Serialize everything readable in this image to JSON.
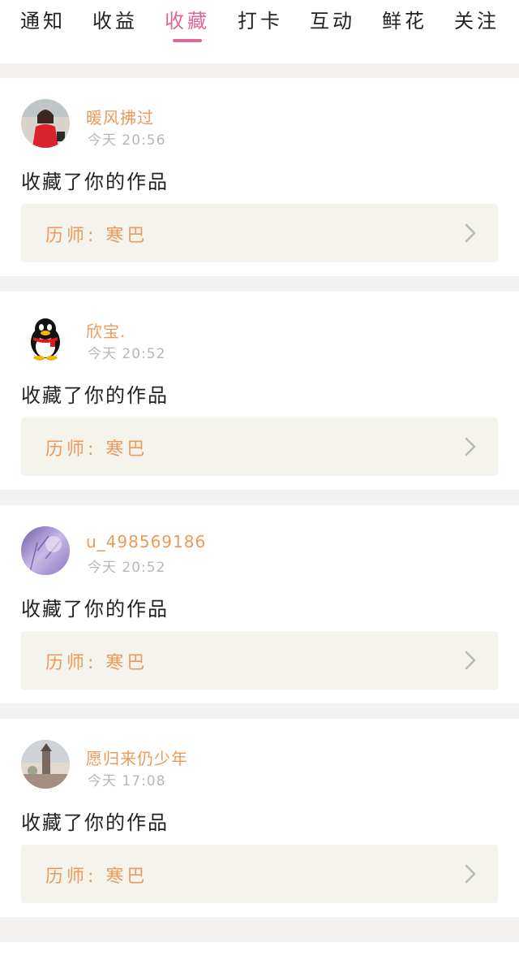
{
  "tabs": [
    {
      "label": "通知"
    },
    {
      "label": "收益"
    },
    {
      "label": "收藏"
    },
    {
      "label": "打卡"
    },
    {
      "label": "互动"
    },
    {
      "label": "鲜花"
    },
    {
      "label": "关注"
    }
  ],
  "active_tab": "收藏",
  "accent_color": "#e0669a",
  "name_color": "#ec9a5c",
  "notifications": [
    {
      "user": "暖风拂过",
      "time": "今天 20:56",
      "action": "收藏了你的作品",
      "work": "历师: 寒巴",
      "avatar": "woman-in-red-avatar"
    },
    {
      "user": "欣宝.",
      "time": "今天 20:52",
      "action": "收藏了你的作品",
      "work": "历师: 寒巴",
      "avatar": "qq-penguin-avatar"
    },
    {
      "user": "u_498569186",
      "time": "今天 20:52",
      "action": "收藏了你的作品",
      "work": "历师: 寒巴",
      "avatar": "purple-landscape-avatar"
    },
    {
      "user": "愿归来仍少年",
      "time": "今天 17:08",
      "action": "收藏了你的作品",
      "work": "历师: 寒巴",
      "avatar": "tower-landscape-avatar"
    }
  ]
}
